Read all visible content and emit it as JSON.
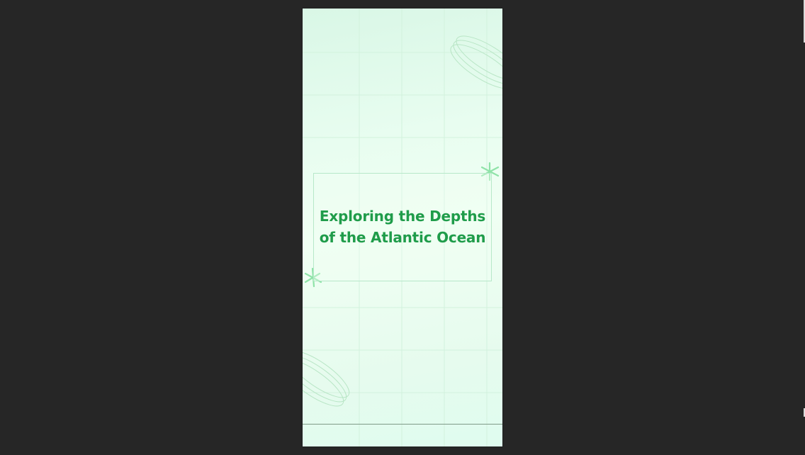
{
  "slide": {
    "title_line1": "Exploring the Depths",
    "title_line2": "of the Atlantic Ocean"
  },
  "colors": {
    "workspace_background": "#262626",
    "title_text": "#1f9c4a",
    "accent_green": "#8fe3a8",
    "grid_line": "#c9efd6"
  },
  "icons": {
    "top_right_decoration": "asterisk-icon",
    "bottom_left_decoration": "asterisk-icon",
    "rings_top": "ellipse-rings-decoration",
    "rings_bottom": "ellipse-rings-decoration"
  }
}
